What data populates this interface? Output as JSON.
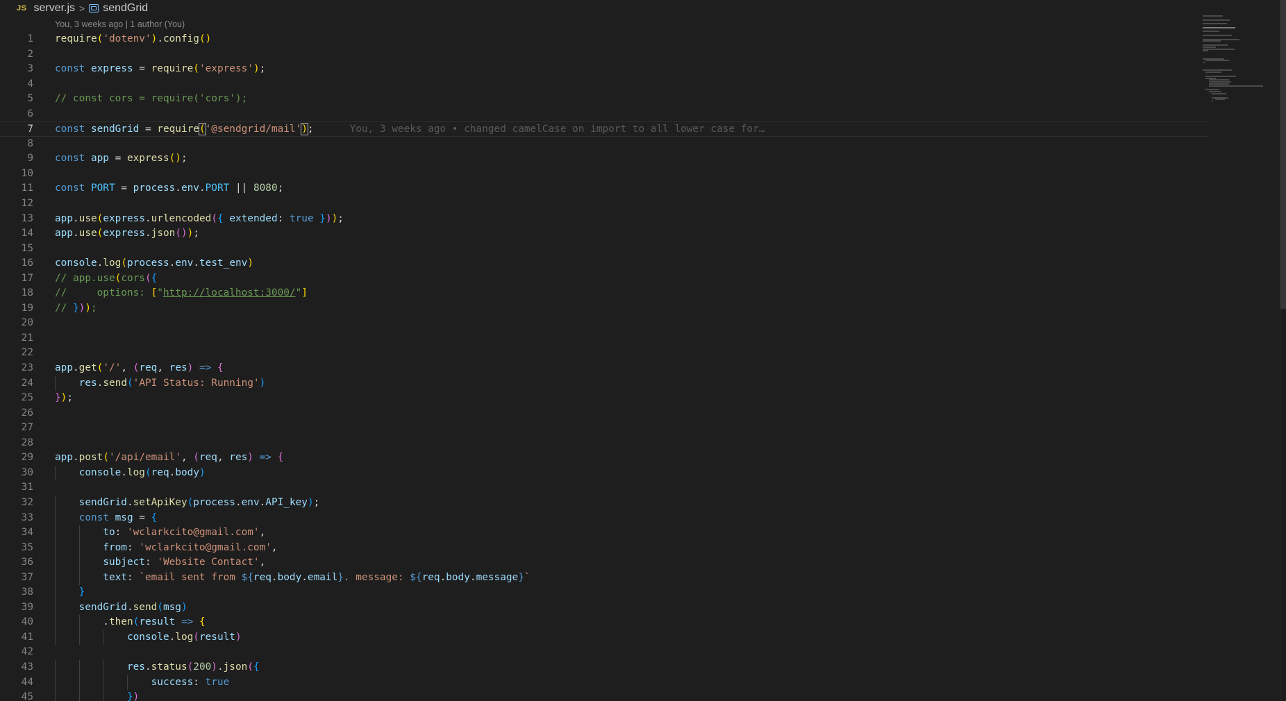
{
  "breadcrumb": {
    "language_badge": "JS",
    "file": "server.js",
    "separator": ">",
    "symbol": "sendGrid",
    "symbol_icon": "symbol-variable-icon"
  },
  "blame_header": "You, 3 weeks ago | 1 author (You)",
  "inline_blame": "You, 3 weeks ago • changed camelCase on import to all lower case for…",
  "lines": [
    {
      "n": "1",
      "t": [
        [
          "fn",
          "require"
        ],
        [
          "b1",
          "("
        ],
        [
          "str",
          "'dotenv'"
        ],
        [
          "b1",
          ")"
        ],
        [
          "plain",
          "."
        ],
        [
          "fn",
          "config"
        ],
        [
          "b1",
          "()"
        ]
      ]
    },
    {
      "n": "2",
      "t": []
    },
    {
      "n": "3",
      "t": [
        [
          "kw",
          "const "
        ],
        [
          "var",
          "express"
        ],
        [
          "plain",
          " = "
        ],
        [
          "fn",
          "require"
        ],
        [
          "b1",
          "("
        ],
        [
          "str",
          "'express'"
        ],
        [
          "b1",
          ")"
        ],
        [
          "plain",
          ";"
        ]
      ]
    },
    {
      "n": "4",
      "t": []
    },
    {
      "n": "5",
      "t": [
        [
          "cm",
          "// const cors = require('cors');"
        ]
      ]
    },
    {
      "n": "6",
      "t": []
    },
    {
      "n": "7",
      "t": [
        [
          "kw",
          "const "
        ],
        [
          "var",
          "sendGrid"
        ],
        [
          "plain",
          " = "
        ],
        [
          "fn",
          "require"
        ],
        [
          "b1",
          "("
        ],
        [
          "str",
          "'@sendgrid/mail'"
        ],
        [
          "b1",
          ")"
        ],
        [
          "plain",
          ";"
        ]
      ]
    },
    {
      "n": "8",
      "t": []
    },
    {
      "n": "9",
      "t": [
        [
          "kw",
          "const "
        ],
        [
          "var",
          "app"
        ],
        [
          "plain",
          " = "
        ],
        [
          "fn",
          "express"
        ],
        [
          "b1",
          "()"
        ],
        [
          "plain",
          ";"
        ]
      ]
    },
    {
      "n": "10",
      "t": []
    },
    {
      "n": "11",
      "t": [
        [
          "kw",
          "const "
        ],
        [
          "const",
          "PORT"
        ],
        [
          "plain",
          " = "
        ],
        [
          "var",
          "process"
        ],
        [
          "plain",
          "."
        ],
        [
          "var",
          "env"
        ],
        [
          "plain",
          "."
        ],
        [
          "const",
          "PORT"
        ],
        [
          "plain",
          " || "
        ],
        [
          "num",
          "8080"
        ],
        [
          "plain",
          ";"
        ]
      ]
    },
    {
      "n": "12",
      "t": []
    },
    {
      "n": "13",
      "t": [
        [
          "var",
          "app"
        ],
        [
          "plain",
          "."
        ],
        [
          "fn",
          "use"
        ],
        [
          "b1",
          "("
        ],
        [
          "var",
          "express"
        ],
        [
          "plain",
          "."
        ],
        [
          "fn",
          "urlencoded"
        ],
        [
          "b2",
          "("
        ],
        [
          "b3",
          "{ "
        ],
        [
          "var",
          "extended"
        ],
        [
          "plain",
          ": "
        ],
        [
          "kw",
          "true"
        ],
        [
          "b3",
          " }"
        ],
        [
          "b2",
          ")"
        ],
        [
          "b1",
          ")"
        ],
        [
          "plain",
          ";"
        ]
      ]
    },
    {
      "n": "14",
      "t": [
        [
          "var",
          "app"
        ],
        [
          "plain",
          "."
        ],
        [
          "fn",
          "use"
        ],
        [
          "b1",
          "("
        ],
        [
          "var",
          "express"
        ],
        [
          "plain",
          "."
        ],
        [
          "fn",
          "json"
        ],
        [
          "b2",
          "()"
        ],
        [
          "b1",
          ")"
        ],
        [
          "plain",
          ";"
        ]
      ]
    },
    {
      "n": "15",
      "t": []
    },
    {
      "n": "16",
      "t": [
        [
          "var",
          "console"
        ],
        [
          "plain",
          "."
        ],
        [
          "fn",
          "log"
        ],
        [
          "b1",
          "("
        ],
        [
          "var",
          "process"
        ],
        [
          "plain",
          "."
        ],
        [
          "var",
          "env"
        ],
        [
          "plain",
          "."
        ],
        [
          "var",
          "test_env"
        ],
        [
          "b1",
          ")"
        ]
      ]
    },
    {
      "n": "17",
      "t": [
        [
          "cm",
          "// app.use"
        ],
        [
          "b1",
          "("
        ],
        [
          "cm",
          "cors"
        ],
        [
          "b2",
          "("
        ],
        [
          "b3",
          "{"
        ]
      ]
    },
    {
      "n": "18",
      "t": [
        [
          "cm",
          "//     options: "
        ],
        [
          "b1",
          "["
        ],
        [
          "cm",
          "\""
        ],
        [
          "cm-link",
          "http://localhost:3000/"
        ],
        [
          "cm",
          "\""
        ],
        [
          "b1",
          "]"
        ]
      ]
    },
    {
      "n": "19",
      "t": [
        [
          "cm",
          "// "
        ],
        [
          "b3",
          "}"
        ],
        [
          "b2",
          ")"
        ],
        [
          "b1",
          ")"
        ],
        [
          "cm",
          ";"
        ]
      ]
    },
    {
      "n": "20",
      "t": []
    },
    {
      "n": "21",
      "t": []
    },
    {
      "n": "22",
      "t": []
    },
    {
      "n": "23",
      "t": [
        [
          "var",
          "app"
        ],
        [
          "plain",
          "."
        ],
        [
          "fn",
          "get"
        ],
        [
          "b1",
          "("
        ],
        [
          "str",
          "'/'"
        ],
        [
          "plain",
          ", "
        ],
        [
          "b2",
          "("
        ],
        [
          "var",
          "req"
        ],
        [
          "plain",
          ", "
        ],
        [
          "var",
          "res"
        ],
        [
          "b2",
          ")"
        ],
        [
          "kw",
          " => "
        ],
        [
          "b2",
          "{"
        ]
      ]
    },
    {
      "n": "24",
      "t": [
        [
          "plain",
          "    "
        ],
        [
          "var",
          "res"
        ],
        [
          "plain",
          "."
        ],
        [
          "fn",
          "send"
        ],
        [
          "b3",
          "("
        ],
        [
          "str",
          "'API Status: Running'"
        ],
        [
          "b3",
          ")"
        ]
      ]
    },
    {
      "n": "25",
      "t": [
        [
          "b2",
          "}"
        ],
        [
          "b1",
          ")"
        ],
        [
          "plain",
          ";"
        ]
      ]
    },
    {
      "n": "26",
      "t": []
    },
    {
      "n": "27",
      "t": []
    },
    {
      "n": "28",
      "t": []
    },
    {
      "n": "29",
      "t": [
        [
          "var",
          "app"
        ],
        [
          "plain",
          "."
        ],
        [
          "fn",
          "post"
        ],
        [
          "b1",
          "("
        ],
        [
          "str",
          "'/api/email'"
        ],
        [
          "plain",
          ", "
        ],
        [
          "b2",
          "("
        ],
        [
          "var",
          "req"
        ],
        [
          "plain",
          ", "
        ],
        [
          "var",
          "res"
        ],
        [
          "b2",
          ")"
        ],
        [
          "kw",
          " => "
        ],
        [
          "b2",
          "{"
        ]
      ]
    },
    {
      "n": "30",
      "t": [
        [
          "plain",
          "    "
        ],
        [
          "var",
          "console"
        ],
        [
          "plain",
          "."
        ],
        [
          "fn",
          "log"
        ],
        [
          "b3",
          "("
        ],
        [
          "var",
          "req"
        ],
        [
          "plain",
          "."
        ],
        [
          "var",
          "body"
        ],
        [
          "b3",
          ")"
        ]
      ]
    },
    {
      "n": "31",
      "t": []
    },
    {
      "n": "32",
      "t": [
        [
          "plain",
          "    "
        ],
        [
          "var",
          "sendGrid"
        ],
        [
          "plain",
          "."
        ],
        [
          "fn",
          "setApiKey"
        ],
        [
          "b3",
          "("
        ],
        [
          "var",
          "process"
        ],
        [
          "plain",
          "."
        ],
        [
          "var",
          "env"
        ],
        [
          "plain",
          "."
        ],
        [
          "var",
          "API_key"
        ],
        [
          "b3",
          ")"
        ],
        [
          "plain",
          ";"
        ]
      ]
    },
    {
      "n": "33",
      "t": [
        [
          "plain",
          "    "
        ],
        [
          "kw",
          "const "
        ],
        [
          "var",
          "msg"
        ],
        [
          "plain",
          " = "
        ],
        [
          "b3",
          "{"
        ]
      ]
    },
    {
      "n": "34",
      "t": [
        [
          "plain",
          "        "
        ],
        [
          "var",
          "to"
        ],
        [
          "plain",
          ": "
        ],
        [
          "str",
          "'wclarkcito@gmail.com'"
        ],
        [
          "plain",
          ","
        ]
      ]
    },
    {
      "n": "35",
      "t": [
        [
          "plain",
          "        "
        ],
        [
          "var",
          "from"
        ],
        [
          "plain",
          ": "
        ],
        [
          "str",
          "'wclarkcito@gmail.com'"
        ],
        [
          "plain",
          ","
        ]
      ]
    },
    {
      "n": "36",
      "t": [
        [
          "plain",
          "        "
        ],
        [
          "var",
          "subject"
        ],
        [
          "plain",
          ": "
        ],
        [
          "str",
          "'Website Contact'"
        ],
        [
          "plain",
          ","
        ]
      ]
    },
    {
      "n": "37",
      "t": [
        [
          "plain",
          "        "
        ],
        [
          "var",
          "text"
        ],
        [
          "plain",
          ": "
        ],
        [
          "str",
          "`email sent from "
        ],
        [
          "kw",
          "${"
        ],
        [
          "var",
          "req"
        ],
        [
          "plain",
          "."
        ],
        [
          "var",
          "body"
        ],
        [
          "plain",
          "."
        ],
        [
          "var",
          "email"
        ],
        [
          "kw",
          "}"
        ],
        [
          "str",
          ". message: "
        ],
        [
          "kw",
          "${"
        ],
        [
          "var",
          "req"
        ],
        [
          "plain",
          "."
        ],
        [
          "var",
          "body"
        ],
        [
          "plain",
          "."
        ],
        [
          "var",
          "message"
        ],
        [
          "kw",
          "}"
        ],
        [
          "str",
          "`"
        ]
      ]
    },
    {
      "n": "38",
      "t": [
        [
          "plain",
          "    "
        ],
        [
          "b3",
          "}"
        ]
      ]
    },
    {
      "n": "39",
      "t": [
        [
          "plain",
          "    "
        ],
        [
          "var",
          "sendGrid"
        ],
        [
          "plain",
          "."
        ],
        [
          "fn",
          "send"
        ],
        [
          "b3",
          "("
        ],
        [
          "var",
          "msg"
        ],
        [
          "b3",
          ")"
        ]
      ]
    },
    {
      "n": "40",
      "t": [
        [
          "plain",
          "        ."
        ],
        [
          "fn",
          "then"
        ],
        [
          "b3",
          "("
        ],
        [
          "var",
          "result"
        ],
        [
          "kw",
          " => "
        ],
        [
          "b1",
          "{"
        ]
      ]
    },
    {
      "n": "41",
      "t": [
        [
          "plain",
          "            "
        ],
        [
          "var",
          "console"
        ],
        [
          "plain",
          "."
        ],
        [
          "fn",
          "log"
        ],
        [
          "b2",
          "("
        ],
        [
          "var",
          "result"
        ],
        [
          "b2",
          ")"
        ]
      ]
    },
    {
      "n": "42",
      "t": []
    },
    {
      "n": "43",
      "t": [
        [
          "plain",
          "            "
        ],
        [
          "var",
          "res"
        ],
        [
          "plain",
          "."
        ],
        [
          "fn",
          "status"
        ],
        [
          "b2",
          "("
        ],
        [
          "num",
          "200"
        ],
        [
          "b2",
          ")"
        ],
        [
          "plain",
          "."
        ],
        [
          "fn",
          "json"
        ],
        [
          "b2",
          "("
        ],
        [
          "b3",
          "{"
        ]
      ]
    },
    {
      "n": "44",
      "t": [
        [
          "plain",
          "                "
        ],
        [
          "var",
          "success"
        ],
        [
          "plain",
          ": "
        ],
        [
          "kw",
          "true"
        ]
      ]
    },
    {
      "n": "45",
      "t": [
        [
          "plain",
          "            "
        ],
        [
          "b3",
          "}"
        ],
        [
          "b2",
          ")"
        ]
      ]
    }
  ],
  "colors": {
    "background": "#1e1e1e",
    "keyword": "#569cd6",
    "string": "#ce9178",
    "comment": "#6a9955",
    "function": "#dcdcaa",
    "variable": "#9cdcfe"
  }
}
